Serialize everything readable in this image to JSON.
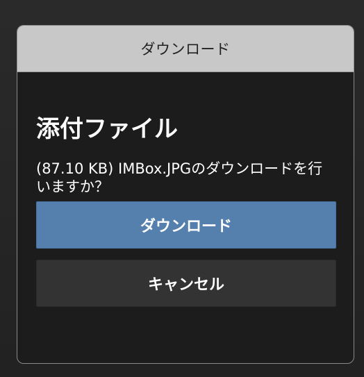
{
  "dialog": {
    "title": "ダウンロード",
    "heading": "添付ファイル",
    "message": "(87.10 KB) IMBox.JPGのダウンロードを行いますか？",
    "download_label": "ダウンロード",
    "cancel_label": "キャンセル"
  }
}
